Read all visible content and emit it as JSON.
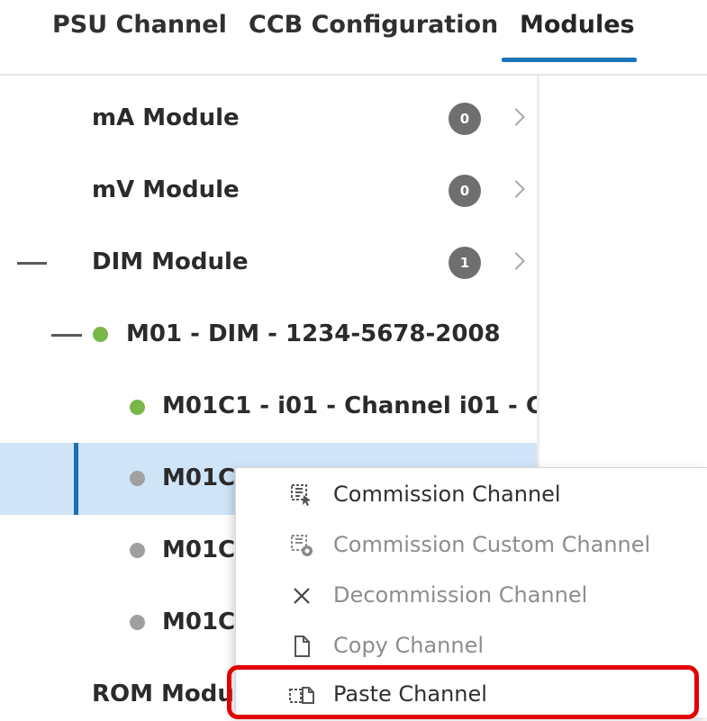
{
  "tabs": [
    {
      "label": "PSU Channel"
    },
    {
      "label": "CCB Configuration"
    },
    {
      "label": "Modules",
      "active": true
    }
  ],
  "tree": {
    "modules": [
      {
        "label": "mA Module",
        "count": "0"
      },
      {
        "label": "mV Module",
        "count": "0"
      },
      {
        "label": "DIM Module",
        "count": "1",
        "expanded": true
      }
    ],
    "device": {
      "label": "M01 - DIM - 1234-5678-2008",
      "status": "online"
    },
    "channels": [
      {
        "label": "M01C1 - i01 - Channel i01 - Ch",
        "status": "commissioned"
      },
      {
        "label": "M01C",
        "status": "not-commissioned",
        "selected": true
      },
      {
        "label": "M01C",
        "status": "not-commissioned"
      },
      {
        "label": "M01C",
        "status": "not-commissioned"
      }
    ],
    "next_module": {
      "label": "ROM Modu"
    }
  },
  "context_menu": {
    "items": [
      {
        "label": "Commission Channel",
        "icon": "commission-icon",
        "enabled": true
      },
      {
        "label": "Commission Custom Channel",
        "icon": "commission-custom-icon",
        "enabled": false
      },
      {
        "label": "Decommission Channel",
        "icon": "close-icon",
        "enabled": false
      },
      {
        "label": "Copy Channel",
        "icon": "document-icon",
        "enabled": false
      },
      {
        "label": "Paste Channel",
        "icon": "paste-icon",
        "enabled": true,
        "highlighted": true
      }
    ]
  },
  "colors": {
    "accent": "#1b74b8",
    "selection": "#cfe4f7",
    "status_green": "#7ab648",
    "status_grey": "#a0a0a0",
    "highlight_red": "#e30000"
  }
}
